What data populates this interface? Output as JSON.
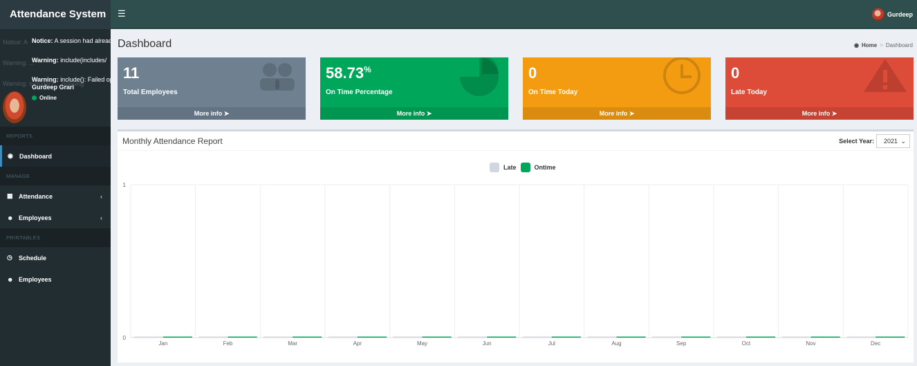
{
  "app": {
    "title": "Attendance System"
  },
  "topbar": {
    "menu_icon": "hamburger-icon",
    "user": "Gurdeep"
  },
  "sidebar": {
    "ghost_warnings": [
      "Notice: A",
      "Warning: ...",
      "Warning: include() ... opening"
    ],
    "notices": [
      {
        "label": "Notice:",
        "text": "A session had already been started"
      },
      {
        "label": "Warning:",
        "text": "include(includes/"
      },
      {
        "label": "Warning:",
        "text": "include(): Failed opening"
      }
    ],
    "user_name": "Gurdeep Grari",
    "status": "Online",
    "sections": {
      "reports": "REPORTS",
      "manage": "MANAGE",
      "printables": "PRINTABLES"
    },
    "items": {
      "dashboard": "Dashboard",
      "attendance": "Attendance",
      "employees": "Employees",
      "schedule": "Schedule",
      "employees_print": "Employees"
    }
  },
  "page": {
    "title": "Dashboard",
    "breadcrumb": {
      "home": "Home",
      "current": "Dashboard",
      "sep": ">"
    }
  },
  "stats": [
    {
      "value": "11",
      "suffix": "",
      "label": "Total Employees",
      "more": "More info",
      "color": "#6f8090",
      "icon": "users-icon"
    },
    {
      "value": "58.73",
      "suffix": "%",
      "label": "On Time Percentage",
      "more": "More info",
      "color": "#00a65a",
      "icon": "pie-chart-icon"
    },
    {
      "value": "0",
      "suffix": "",
      "label": "On Time Today",
      "more": "More info",
      "color": "#f39c12",
      "icon": "clock-icon"
    },
    {
      "value": "0",
      "suffix": "",
      "label": "Late Today",
      "more": "More info",
      "color": "#dd4b39",
      "icon": "warning-icon"
    }
  ],
  "report": {
    "title": "Monthly Attendance Report",
    "select_label": "Select Year:",
    "year": "2021"
  },
  "chart_data": {
    "type": "bar",
    "categories": [
      "Jan",
      "Feb",
      "Mar",
      "Apr",
      "May",
      "Jun",
      "Jul",
      "Aug",
      "Sep",
      "Oct",
      "Nov",
      "Dec"
    ],
    "series": [
      {
        "name": "Late",
        "color": "#d2d6de",
        "values": [
          0,
          0,
          0,
          0,
          0,
          0,
          0,
          0,
          0,
          0,
          0,
          0
        ]
      },
      {
        "name": "Ontime",
        "color": "#00a65a",
        "values": [
          0,
          0,
          0,
          0,
          0,
          0,
          0,
          0,
          0,
          0,
          0,
          0
        ]
      }
    ],
    "ylim": [
      0,
      1
    ],
    "yticks": [
      "0",
      "1"
    ],
    "grid": true,
    "legend": "top-center"
  }
}
